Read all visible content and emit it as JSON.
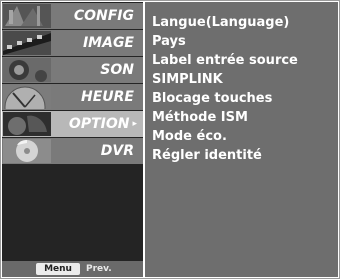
{
  "menu": {
    "items": [
      {
        "label": "CONFIG",
        "icon": "config-thumbnail-icon",
        "selected": false
      },
      {
        "label": "IMAGE",
        "icon": "image-thumbnail-icon",
        "selected": false
      },
      {
        "label": "SON",
        "icon": "son-thumbnail-icon",
        "selected": false
      },
      {
        "label": "HEURE",
        "icon": "heure-thumbnail-icon",
        "selected": false
      },
      {
        "label": "OPTION",
        "icon": "option-thumbnail-icon",
        "selected": true
      },
      {
        "label": "DVR",
        "icon": "dvr-thumbnail-icon",
        "selected": false
      }
    ],
    "selected_arrow": "▸"
  },
  "footer": {
    "menu_key": "Menu",
    "prev_label": "Prev."
  },
  "option_panel": {
    "items": [
      "Langue(Language)",
      "Pays",
      "Label entrée source",
      "SIMPLINK",
      "Blocage touches",
      "Méthode ISM",
      "Mode éco.",
      "Régler identité"
    ]
  },
  "colors": {
    "menu_background": "#242424",
    "menu_item": "#7a7a7a",
    "menu_item_selected": "#b8b8b8",
    "panel_background": "#6e6e6e",
    "text": "#ffffff"
  }
}
